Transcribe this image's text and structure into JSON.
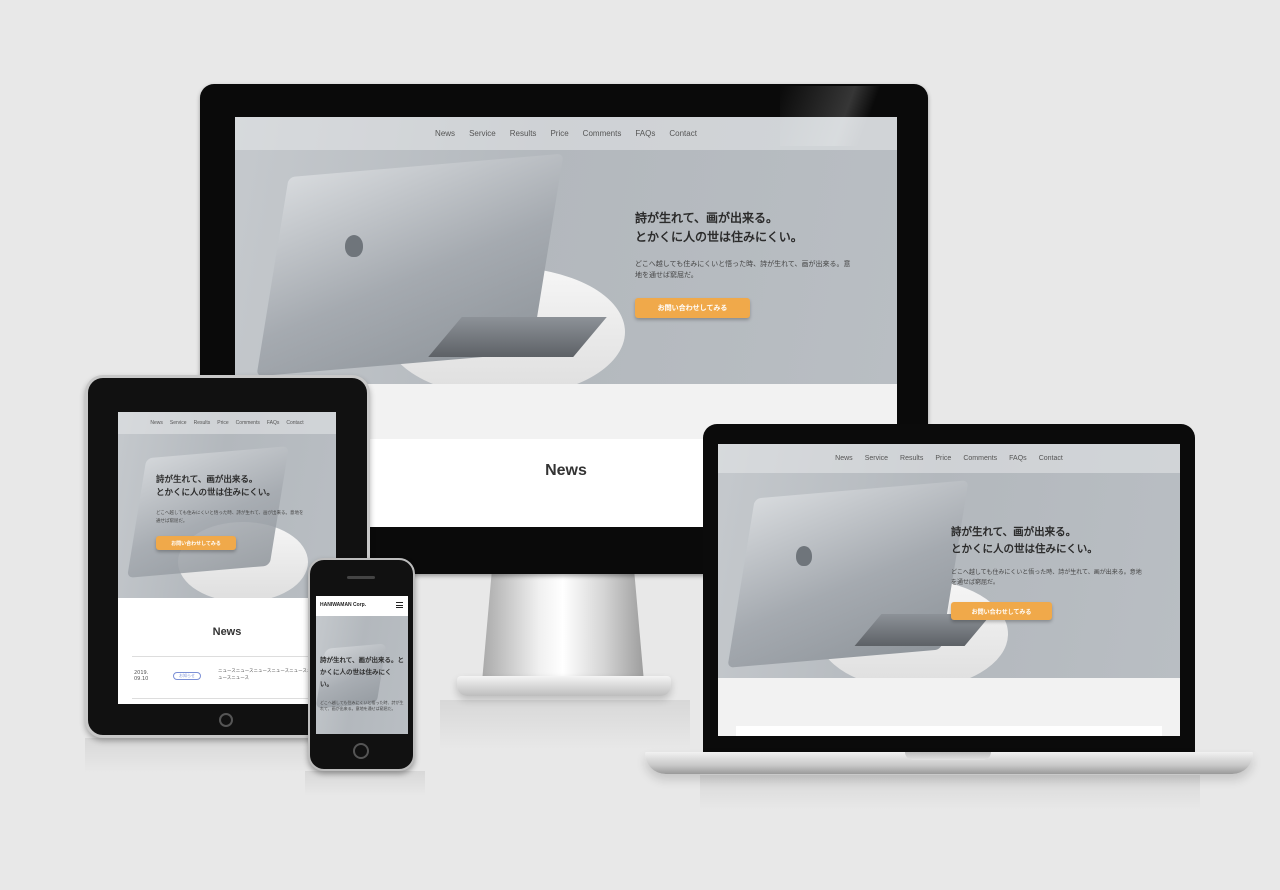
{
  "nav": [
    "News",
    "Service",
    "Results",
    "Price",
    "Comments",
    "FAQs",
    "Contact"
  ],
  "hero": {
    "headline_line1": "詩が生れて、画が出来る。",
    "headline_line2": "とかくに人の世は住みにくい。",
    "subtext": "どこへ越しても住みにくいと悟った時、詩が生れて、画が出来る。意地を通せば窮屈だ。",
    "cta_label": "お問い合わせしてみる"
  },
  "news": {
    "title": "News",
    "date": "2019.\n09.10",
    "tag": "お知らせ",
    "text": "ニュースニュースニュースニュースニュースニュースニュース"
  },
  "phone": {
    "brand": "HANIWAMAN Corp.",
    "headline": "詩が生れて、画が出来る。とかくに人の世は住みにく い。",
    "subtext": "どこへ越しても住みにくいと悟った時、詩が生れて、画が出来る。意地を通せば窮屈だ。"
  },
  "colors": {
    "accent": "#f0a94a",
    "background": "#e8e8e8",
    "frame": "#0a0a0a"
  }
}
